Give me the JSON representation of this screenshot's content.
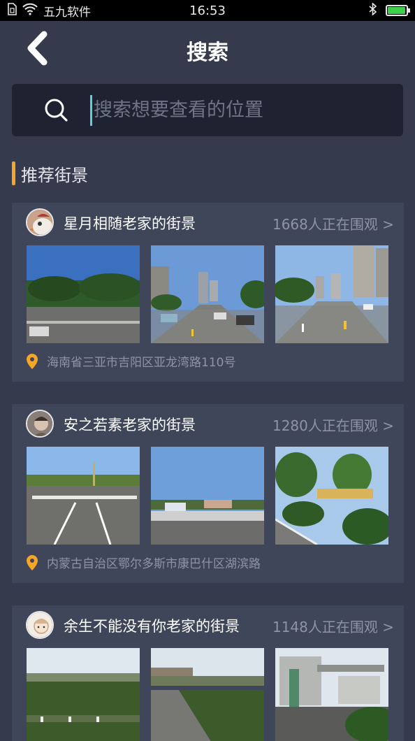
{
  "status_bar": {
    "carrier": "五九软件",
    "time": "16:53",
    "battery_percent": 95,
    "battery_color": "#3cd04a"
  },
  "header": {
    "title": "搜索",
    "back_icon": "chevron-left-icon"
  },
  "search": {
    "placeholder": "搜索想要查看的位置",
    "value": "",
    "icon": "search-icon"
  },
  "section": {
    "title": "推荐街景",
    "accent_color": "#f5a623"
  },
  "cards": [
    {
      "title": "星月相随老家的街景",
      "watchers": "1668人正在围观 >",
      "location": "海南省三亚市吉阳区亚龙湾路110号"
    },
    {
      "title": "安之若素老家的街景",
      "watchers": "1280人正在围观 >",
      "location": "内蒙古自治区鄂尔多斯市康巴什区湖滨路"
    },
    {
      "title": "余生不能没有你老家的街景",
      "watchers": "1148人正在围观 >",
      "location": ""
    }
  ]
}
